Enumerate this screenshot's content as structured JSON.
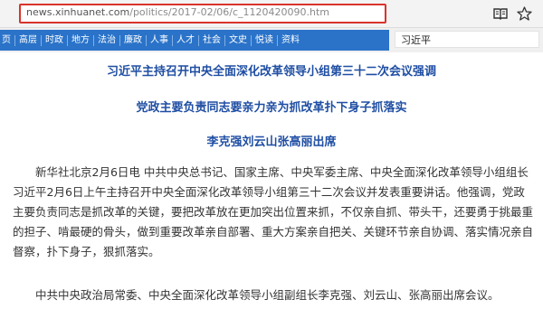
{
  "browser": {
    "url_domain": "news.xinhuanet.com",
    "url_path": "/politics/2017-02/06/c_1120420090.htm",
    "reader_icon": "book-icon",
    "favorite_icon": "star-icon"
  },
  "nav": {
    "items": [
      {
        "label": "页"
      },
      {
        "label": "高层"
      },
      {
        "label": "时政"
      },
      {
        "label": "地方"
      },
      {
        "label": "法治"
      },
      {
        "label": "廉政"
      },
      {
        "label": "人事"
      },
      {
        "label": "人才"
      },
      {
        "label": "社会"
      },
      {
        "label": "文史"
      },
      {
        "label": "悦读"
      },
      {
        "label": "资料"
      }
    ],
    "accent": "#2a73c9"
  },
  "search": {
    "value": "习近平"
  },
  "article": {
    "title": "习近平主持召开中央全面深化改革领导小组第三十二次会议强调",
    "subtitle": "党政主要负责同志要亲力亲为抓改革扑下身子抓落实",
    "subtitle2": "李克强刘云山张高丽出席",
    "paragraphs": [
      "新华社北京2月6日电 中共中央总书记、国家主席、中央军委主席、中央全面深化改革领导小组组长习近平2月6日上午主持召开中央全面深化改革领导小组第三十二次会议并发表重要讲话。他强调，党政主要负责同志是抓改革的关键，要把改革放在更加突出位置来抓，不仅亲自抓、带头干，还要勇于挑最重的担子、啃最硬的骨头，做到重要改革亲自部署、重大方案亲自把关、关键环节亲自协调、落实情况亲自督察，扑下身子，狠抓落实。",
      "中共中央政治局常委、中央全面深化改革领导小组副组长李克强、刘云山、张高丽出席会议。"
    ],
    "title_color": "#1f4ea3"
  }
}
